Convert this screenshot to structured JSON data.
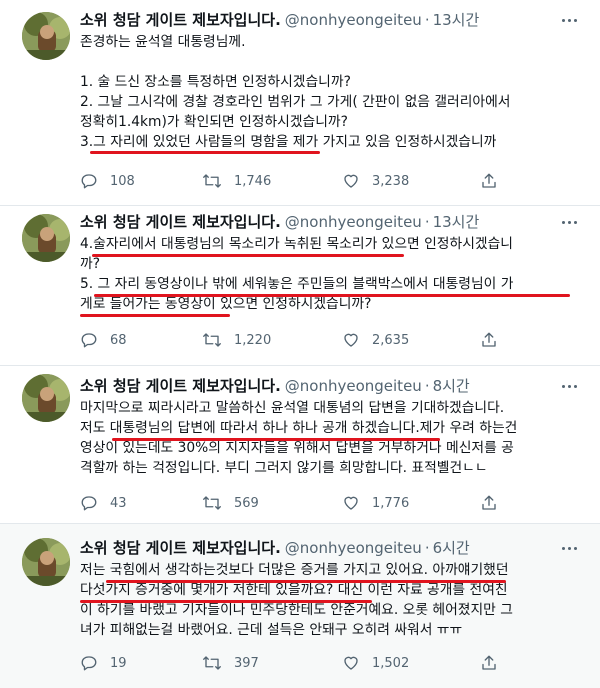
{
  "tweets": [
    {
      "author": {
        "display_name": "소위 청담 게이트 제보자입니다.",
        "handle": "@nonhyeongeiteu"
      },
      "time": "13시간",
      "lines": [
        "존경하는 윤석열 대통령님께.",
        "",
        "1. 술 드신 장소를 특정하면 인정하시겠습니까?",
        "2. 그날 그시각에 경찰 경호라인 범위가 그 가게( 간판이 없음 갤러리아에서",
        "정확히1.4km)가 확인되면 인정하시겠습니까?",
        "3.그 자리에 있었던 사람들의 명함을 제가 가지고 있음 인정하시겠습니까"
      ],
      "stats": {
        "replies": "108",
        "retweets": "1,746",
        "likes": "3,238"
      }
    },
    {
      "author": {
        "display_name": "소위 청담 게이트 제보자입니다.",
        "handle": "@nonhyeongeiteu"
      },
      "time": "13시간",
      "lines": [
        "4.술자리에서 대통령님의 목소리가 녹취된 목소리가 있으면 인정하시겠습니",
        "까?",
        "5. 그 자리 동영상이나 밖에 세워놓은 주민들의 블랙박스에서 대통령님이 가",
        "게로 들어가는 동영상이 있으면 인정하시겠습니까?"
      ],
      "stats": {
        "replies": "68",
        "retweets": "1,220",
        "likes": "2,635"
      }
    },
    {
      "author": {
        "display_name": "소위 청담 게이트 제보자입니다.",
        "handle": "@nonhyeongeiteu"
      },
      "time": "8시간",
      "lines": [
        "마지막으로 찌라시라고 말씀하신 윤석열 대통념의 답변을 기대하겠습니다.",
        "저도 대통령님의 답변에 따라서 하나 하나 공개 하겠습니다.제가 우려 하는건",
        "영상이 있는데도 30%의 지지자들을 위해서 답변을 거부하거나 메신저를 공",
        "격할까 하는 걱정입니다. 부디 그러지 않기를 희망합니다. 표적볠건ㄴㄴ"
      ],
      "stats": {
        "replies": "43",
        "retweets": "569",
        "likes": "1,776"
      }
    },
    {
      "author": {
        "display_name": "소위 청담 게이트 제보자입니다.",
        "handle": "@nonhyeongeiteu"
      },
      "time": "6시간",
      "lines": [
        "저는 국힘에서 생각하는것보다 더많은 증거를 가지고 있어요. 아까얘기했던",
        "다섯가지 증거중에 몇개가 저한테 있을까요? 대신 이런 자료 공개를 전여친",
        "이 하기를 바랬고 기자들이나 민주당한테도 안준거예요. 오롯 헤어졌지만 그",
        "녀가 피해없는걸 바랬어요. 근데 설득은 안돼구 오히려 싸워서 ㅠㅠ"
      ],
      "stats": {
        "replies": "19",
        "retweets": "397",
        "likes": "1,502"
      }
    }
  ],
  "icons": [
    "reply-icon",
    "retweet-icon",
    "like-icon",
    "share-icon",
    "more-icon"
  ],
  "colors": {
    "underline": "#e0141e",
    "secondary_text": "#536471",
    "shaded_bg": "#f7f9f9"
  }
}
